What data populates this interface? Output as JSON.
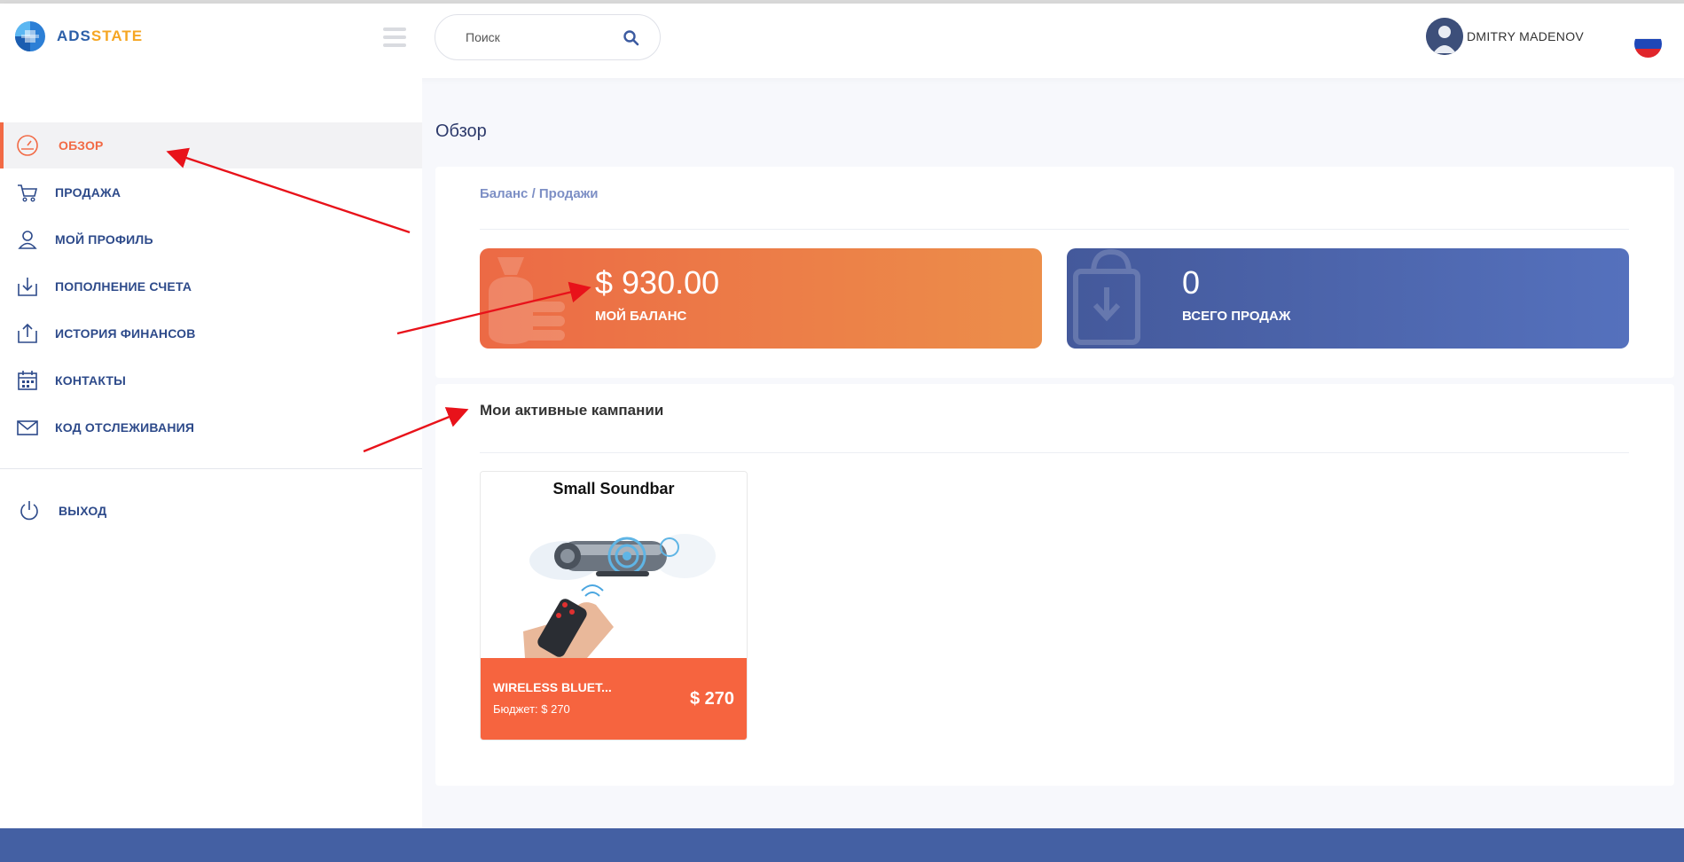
{
  "brand": {
    "logo_part1": "ADS",
    "logo_part2": "STATE"
  },
  "header": {
    "search_placeholder": "Поиск",
    "user_name": "DMITRY MADENOV"
  },
  "sidebar": {
    "items": [
      {
        "label": "ОБЗОР",
        "icon": "dashboard-icon",
        "active": true
      },
      {
        "label": "ПРОДАЖА",
        "icon": "cart-icon"
      },
      {
        "label": "МОЙ ПРОФИЛЬ",
        "icon": "user-icon"
      },
      {
        "label": "ПОПОЛНЕНИЕ СЧЕТА",
        "icon": "download-icon"
      },
      {
        "label": "ИСТОРИЯ ФИНАНСОВ",
        "icon": "upload-icon"
      },
      {
        "label": "КОНТАКТЫ",
        "icon": "calendar-icon"
      },
      {
        "label": "КОД ОТСЛЕЖИВАНИЯ",
        "icon": "mail-icon"
      }
    ],
    "logout_label": "ВЫХОД"
  },
  "main": {
    "page_title": "Обзор",
    "balance_card": {
      "title": "Баланс / Продажи",
      "balance_value": "$ 930.00",
      "balance_label": "МОЙ БАЛАНС",
      "sales_value": "0",
      "sales_label": "ВСЕГО ПРОДАЖ"
    },
    "campaigns": {
      "title": "Мои активные кампании",
      "items": [
        {
          "image_title": "Small  Soundbar",
          "name": "WIRELESS BLUET...",
          "budget": "Бюджет: $ 270",
          "price": "$ 270"
        }
      ]
    }
  },
  "colors": {
    "accent_orange": "#f26a45",
    "accent_blue": "#4460a3",
    "nav_text": "#2d4a8a"
  }
}
